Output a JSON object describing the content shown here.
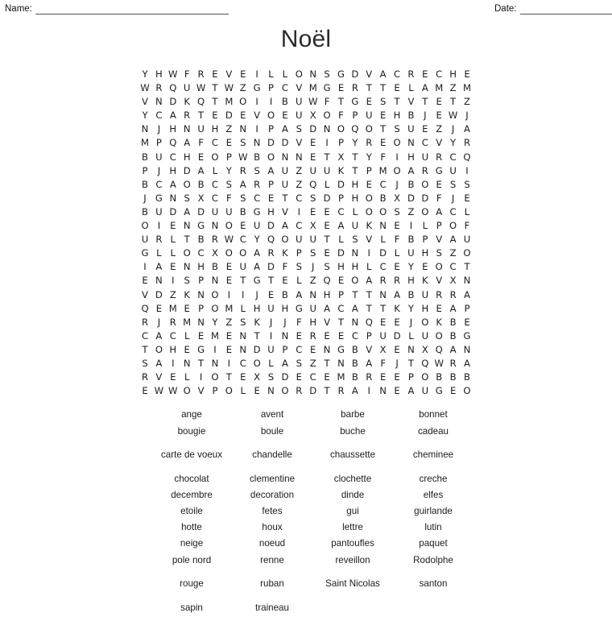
{
  "header": {
    "name_label": "Name:",
    "date_label": "Date:"
  },
  "title": "Noël",
  "grid": {
    "rows": 24,
    "cols": 23,
    "letters": [
      "Y H W F R E V E I L L O N S G D V A C R E C H E",
      "W R Q U W T W Z G P C V M G E R T T E L A M Z M",
      "V N D K Q T M O I I B U W F T G E S T V T E T Z",
      "Y C A R T E D E V O E U X O F P U E H B J E W J",
      "N J H N U H Z N I P A S D N O Q O T S U E Z J A",
      "M P Q A F C E S N D D V E I P Y R E O N C V Y R",
      "B U C H E O P W B O N N E T X T Y F I H U R C Q",
      "P J H D A L Y R S A U Z U U K T P M O A R G U I",
      "B C A O B C S A R P U Z Q L D H E C J B O E S S",
      "J G N S X C F S C E T C S D P H O B X D D F J E",
      "B U D A D U U B G H V I E E C L O O S Z O A C L",
      "O I E N G N O E U D A C X E A U K N E I L P O F",
      "U R L T B R W C Y Q O U U T L S V L F B P V A U",
      "G L L O C X O O A R K P S E D N I D L U H S Z O",
      "I A E N H B E U A D F S J S H H L C E Y E O C T",
      "E N I S P N E T G T E L Z Q E O A R R H K V X N",
      "V D Z K N O I I J E B A N H P T T N A B U R R A",
      "Q E M E P O M L H U H G U A C A T T K Y H E A P",
      "R J R M N Y Z S K J J F H V T N Q E E J O K B E",
      "C A C L E M E N T I N E R E E C P U D L U O B G",
      "T O H E G I E N D U P C E N G B V X E N X Q A N",
      "S A I N T N I C O L A S Z T N B A F J T Q W R A",
      "R V E L I O T E X S D E C E M B R E E P O B B B",
      "E W W O V P O L E N O R D T R A I N E A U G E O"
    ]
  },
  "wordlist": {
    "columns": 4,
    "words": [
      "ange",
      "avent",
      "barbe",
      "bonnet",
      "bougie",
      "boule",
      "buche",
      "cadeau",
      "carte de voeux",
      "chandelle",
      "chaussette",
      "cheminee",
      "chocolat",
      "clementine",
      "clochette",
      "creche",
      "decembre",
      "decoration",
      "dinde",
      "elfes",
      "etoile",
      "fetes",
      "gui",
      "guirlande",
      "hotte",
      "houx",
      "lettre",
      "lutin",
      "neige",
      "noeud",
      "pantoufles",
      "paquet",
      "pole nord",
      "renne",
      "reveillon",
      "Rodolphe",
      "rouge",
      "ruban",
      "Saint Nicolas",
      "santon",
      "sapin",
      "traineau",
      "",
      ""
    ]
  }
}
